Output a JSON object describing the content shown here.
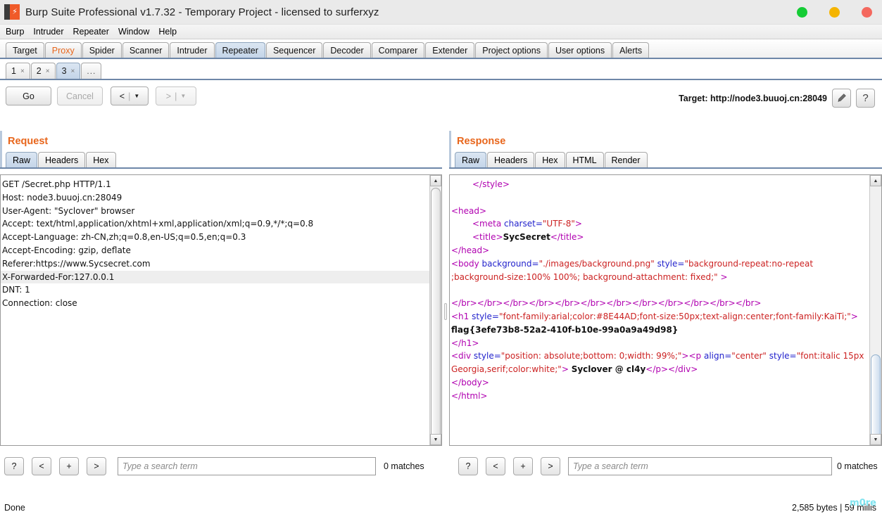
{
  "window": {
    "title": "Burp Suite Professional v1.7.32 - Temporary Project - licensed to surferxyz",
    "logo_icon": "burp-logo-icon",
    "controls": [
      {
        "name": "minimize",
        "icon": "circle-green-icon",
        "color": "#15cc35"
      },
      {
        "name": "maximize",
        "icon": "circle-amber-icon",
        "color": "#f5b400"
      },
      {
        "name": "close",
        "icon": "circle-red-icon",
        "color": "#f4685e"
      }
    ]
  },
  "menubar": [
    "Burp",
    "Intruder",
    "Repeater",
    "Window",
    "Help"
  ],
  "main_tabs": [
    {
      "label": "Target",
      "selected": false,
      "accent": false
    },
    {
      "label": "Proxy",
      "selected": false,
      "accent": true
    },
    {
      "label": "Spider",
      "selected": false,
      "accent": false
    },
    {
      "label": "Scanner",
      "selected": false,
      "accent": false
    },
    {
      "label": "Intruder",
      "selected": false,
      "accent": false
    },
    {
      "label": "Repeater",
      "selected": true,
      "accent": false
    },
    {
      "label": "Sequencer",
      "selected": false,
      "accent": false
    },
    {
      "label": "Decoder",
      "selected": false,
      "accent": false
    },
    {
      "label": "Comparer",
      "selected": false,
      "accent": false
    },
    {
      "label": "Extender",
      "selected": false,
      "accent": false
    },
    {
      "label": "Project options",
      "selected": false,
      "accent": false
    },
    {
      "label": "User options",
      "selected": false,
      "accent": false
    },
    {
      "label": "Alerts",
      "selected": false,
      "accent": false
    }
  ],
  "repeater_tabs": [
    {
      "label": "1",
      "close": "×",
      "selected": false
    },
    {
      "label": "2",
      "close": "×",
      "selected": false
    },
    {
      "label": "3",
      "close": "×",
      "selected": true
    }
  ],
  "repeater_tabs_more": "...",
  "toolbar": {
    "go_label": "Go",
    "cancel_label": "Cancel",
    "back_label": "<",
    "forward_label": ">",
    "separator": "|",
    "caret": "▼",
    "target_label": "Target: http://node3.buuoj.cn:28049",
    "edit_icon": "pencil-icon",
    "help_label": "?"
  },
  "request": {
    "title": "Request",
    "tabs": [
      {
        "label": "Raw",
        "selected": true
      },
      {
        "label": "Headers",
        "selected": false
      },
      {
        "label": "Hex",
        "selected": false
      }
    ],
    "lines": [
      {
        "text": "GET /Secret.php HTTP/1.1",
        "highlight": false
      },
      {
        "text": "Host: node3.buuoj.cn:28049",
        "highlight": false
      },
      {
        "text": "User-Agent: \"Syclover\" browser",
        "highlight": false
      },
      {
        "text": "Accept: text/html,application/xhtml+xml,application/xml;q=0.9,*/*;q=0.8",
        "highlight": false
      },
      {
        "text": "Accept-Language: zh-CN,zh;q=0.8,en-US;q=0.5,en;q=0.3",
        "highlight": false
      },
      {
        "text": "Accept-Encoding: gzip, deflate",
        "highlight": false
      },
      {
        "text": "Referer:https://www.Sycsecret.com",
        "highlight": false
      },
      {
        "text": "X-Forwarded-For:127.0.0.1",
        "highlight": true
      },
      {
        "text": "DNT: 1",
        "highlight": false
      },
      {
        "text": "Connection: close",
        "highlight": false
      }
    ],
    "search": {
      "help_label": "?",
      "prev_label": "<",
      "add_label": "+",
      "next_label": ">",
      "placeholder": "Type a search term",
      "value": "",
      "matches": "0 matches"
    }
  },
  "response": {
    "title": "Response",
    "tabs": [
      {
        "label": "Raw",
        "selected": true
      },
      {
        "label": "Headers",
        "selected": false
      },
      {
        "label": "Hex",
        "selected": false
      },
      {
        "label": "HTML",
        "selected": false
      },
      {
        "label": "Render",
        "selected": false
      }
    ],
    "lines": [
      [
        {
          "t": "",
          "c": "ind"
        },
        {
          "t": "</style>",
          "c": "tg"
        }
      ],
      [],
      [
        {
          "t": "<head>",
          "c": "tg"
        }
      ],
      [
        {
          "t": "",
          "c": "ind"
        },
        {
          "t": "<meta ",
          "c": "tg"
        },
        {
          "t": "charset=",
          "c": "an"
        },
        {
          "t": "\"UTF-8\"",
          "c": "av"
        },
        {
          "t": ">",
          "c": "tg"
        }
      ],
      [
        {
          "t": "",
          "c": "ind"
        },
        {
          "t": "<title>",
          "c": "tg"
        },
        {
          "t": "SycSecret",
          "c": "tx"
        },
        {
          "t": "</title>",
          "c": "tg"
        }
      ],
      [
        {
          "t": "</head>",
          "c": "tg"
        }
      ],
      [
        {
          "t": "<body ",
          "c": "tg"
        },
        {
          "t": "background=",
          "c": "an"
        },
        {
          "t": "\"./images/background.png\"",
          "c": "av"
        },
        {
          "t": " ",
          "c": "tg"
        },
        {
          "t": "style=",
          "c": "an"
        },
        {
          "t": "\"background-repeat:no-repeat",
          "c": "av"
        }
      ],
      [
        {
          "t": ";background-size:100% 100%; background-attachment: fixed;\" ",
          "c": "av"
        },
        {
          "t": ">",
          "c": "tg"
        }
      ],
      [],
      [
        {
          "t": "</br></br></br></br></br></br></br></br></br></br></br></br>",
          "c": "tg"
        }
      ],
      [
        {
          "t": "<h1 ",
          "c": "tg"
        },
        {
          "t": "style=",
          "c": "an"
        },
        {
          "t": "\"font-family:arial;color:#8E44AD;font-size:50px;text-align:center;font-family:KaiTi;\"",
          "c": "av"
        },
        {
          "t": ">",
          "c": "tg"
        }
      ],
      [
        {
          "t": "flag{3efe73b8-52a2-410f-b10e-99a0a9a49d98}",
          "c": "tx"
        }
      ],
      [
        {
          "t": "</h1>",
          "c": "tg"
        }
      ],
      [
        {
          "t": "<div ",
          "c": "tg"
        },
        {
          "t": "style=",
          "c": "an"
        },
        {
          "t": "\"position: absolute;bottom: 0;width: 99%;\"",
          "c": "av"
        },
        {
          "t": ">",
          "c": "tg"
        },
        {
          "t": "<p ",
          "c": "tg"
        },
        {
          "t": "align=",
          "c": "an"
        },
        {
          "t": "\"center\"",
          "c": "av"
        },
        {
          "t": " ",
          "c": "tg"
        },
        {
          "t": "style=",
          "c": "an"
        },
        {
          "t": "\"font:italic 15px",
          "c": "av"
        }
      ],
      [
        {
          "t": "Georgia,serif;color:white;\"",
          "c": "av"
        },
        {
          "t": "> ",
          "c": "tg"
        },
        {
          "t": "Syclover @ cl4y",
          "c": "tx"
        },
        {
          "t": "</p></div>",
          "c": "tg"
        }
      ],
      [
        {
          "t": "</body>",
          "c": "tg"
        }
      ],
      [
        {
          "t": "</html>",
          "c": "tg"
        }
      ]
    ],
    "flag": "flag{3efe73b8-52a2-410f-b10e-99a0a9a49d98}",
    "search": {
      "help_label": "?",
      "prev_label": "<",
      "add_label": "+",
      "next_label": ">",
      "placeholder": "Type a search term",
      "value": "",
      "matches": "0 matches"
    }
  },
  "statusbar": {
    "left": "Done",
    "right": "2,585 bytes | 59 millis",
    "watermark": "m0re"
  },
  "colors": {
    "accent_orange": "#e8661c",
    "tab_selected": "#c3d4e8",
    "tab_underline": "#6e87a8",
    "syntax_tag": "#b000b0",
    "syntax_attr": "#2222cc",
    "syntax_value": "#cc2222",
    "watermark": "#7fe3ef"
  }
}
